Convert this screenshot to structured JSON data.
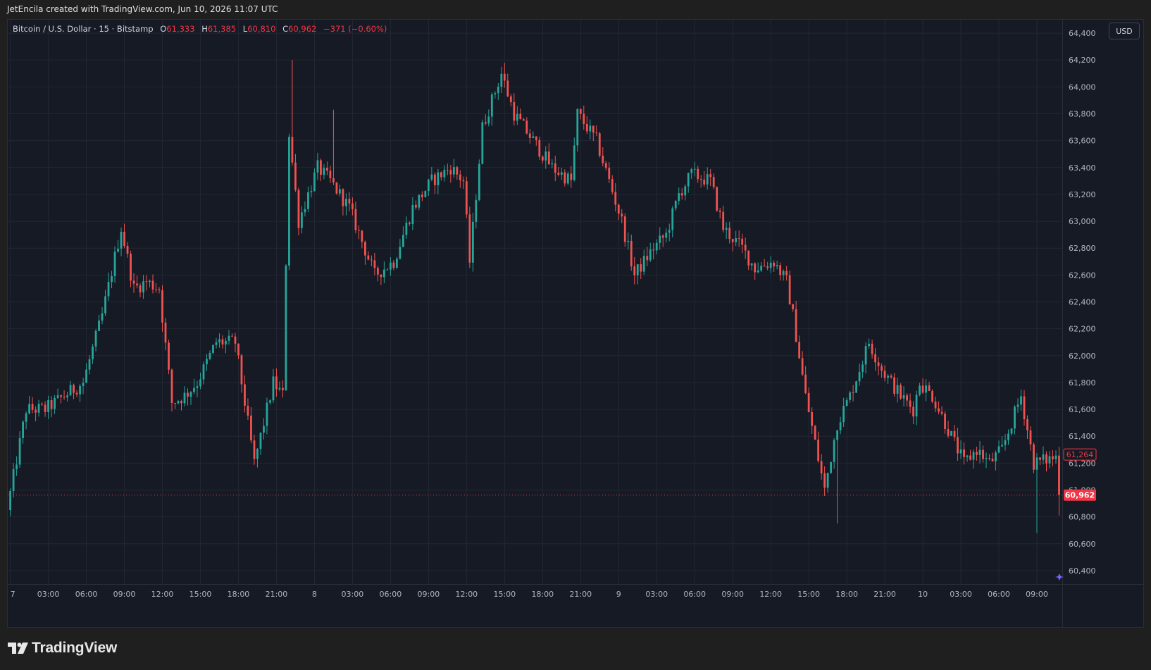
{
  "caption": "JetEncila created with TradingView.com, Jun 10, 2026 11:07 UTC",
  "legend": {
    "symbol": "Bitcoin / U.S. Dollar · 15 · Bitstamp",
    "open_label": "O",
    "open": "61,333",
    "high_label": "H",
    "high": "61,385",
    "low_label": "L",
    "low": "60,810",
    "close_label": "C",
    "close": "60,962",
    "change": "−371 (−0.60%)"
  },
  "currency_button": "USD",
  "footer_brand": "TradingView",
  "colors": {
    "up": "#26a69a",
    "down": "#ef5350",
    "background": "#161a25",
    "grid": "#232733",
    "axis_text": "#b2b5be",
    "last_price_bg": "#f23645",
    "prev_label_border": "#f23645",
    "accent_marker": "#7b61ff"
  },
  "chart_data": {
    "type": "candlestick",
    "symbol": "Bitcoin / U.S. Dollar",
    "interval": "15",
    "exchange": "Bitstamp",
    "currency": "USD",
    "ylim": [
      60300,
      64500
    ],
    "y_ticks": [
      60400,
      60600,
      60800,
      61000,
      61200,
      61400,
      61600,
      61800,
      62000,
      62200,
      62400,
      62600,
      62800,
      63000,
      63200,
      63400,
      63600,
      63800,
      64000,
      64200,
      64400
    ],
    "y_tick_labels": [
      "60,400",
      "60,600",
      "60,800",
      "61,000",
      "61,200",
      "61,400",
      "61,600",
      "61,800",
      "62,000",
      "62,200",
      "62,400",
      "62,600",
      "62,800",
      "63,000",
      "63,200",
      "63,400",
      "63,600",
      "63,800",
      "64,000",
      "64,200",
      "64,400"
    ],
    "x_ticks": [
      "7",
      "03:00",
      "06:00",
      "09:00",
      "12:00",
      "15:00",
      "18:00",
      "21:00",
      "8",
      "03:00",
      "06:00",
      "09:00",
      "12:00",
      "15:00",
      "18:00",
      "21:00",
      "9",
      "03:00",
      "06:00",
      "09:00",
      "12:00",
      "15:00",
      "18:00",
      "21:00",
      "10",
      "03:00",
      "06:00",
      "09:00"
    ],
    "x_tick_hours": [
      0,
      3,
      6,
      9,
      12,
      15,
      18,
      21,
      24,
      27,
      30,
      33,
      36,
      39,
      42,
      45,
      48,
      51,
      54,
      57,
      60,
      63,
      66,
      69,
      72,
      75,
      78,
      81
    ],
    "x_range_hours": [
      -0.2,
      83.0
    ],
    "candle_minutes": 15,
    "last_price": 60962,
    "last_price_label": "60,962",
    "prev_price": 61264,
    "prev_price_label": "61,264",
    "price_path": [
      [
        0,
        60850
      ],
      [
        1.5,
        61600
      ],
      [
        3,
        61600
      ],
      [
        4.5,
        61700
      ],
      [
        6,
        61800
      ],
      [
        7.5,
        62300
      ],
      [
        9,
        62950
      ],
      [
        10,
        62500
      ],
      [
        11,
        62550
      ],
      [
        12,
        62500
      ],
      [
        13,
        61650
      ],
      [
        14,
        61700
      ],
      [
        15,
        61800
      ],
      [
        16.5,
        62100
      ],
      [
        18,
        62100
      ],
      [
        19.5,
        61200
      ],
      [
        21,
        61800
      ],
      [
        21.8,
        61700
      ],
      [
        22.2,
        63700
      ],
      [
        23,
        63000
      ],
      [
        24.5,
        63400
      ],
      [
        25.5,
        63300
      ],
      [
        27,
        63100
      ],
      [
        29,
        62600
      ],
      [
        30.5,
        62700
      ],
      [
        32,
        63100
      ],
      [
        33.5,
        63300
      ],
      [
        35,
        63400
      ],
      [
        36,
        63300
      ],
      [
        36.5,
        62700
      ],
      [
        37.5,
        63700
      ],
      [
        39,
        64100
      ],
      [
        40,
        63800
      ],
      [
        41.5,
        63600
      ],
      [
        43,
        63400
      ],
      [
        44.5,
        63300
      ],
      [
        45,
        63800
      ],
      [
        46.5,
        63600
      ],
      [
        47.5,
        63300
      ],
      [
        48.5,
        63000
      ],
      [
        49.5,
        62600
      ],
      [
        51,
        62800
      ],
      [
        52,
        62900
      ],
      [
        53,
        63200
      ],
      [
        54,
        63350
      ],
      [
        55.5,
        63300
      ],
      [
        56.5,
        62950
      ],
      [
        58,
        62800
      ],
      [
        59,
        62650
      ],
      [
        60.5,
        62700
      ],
      [
        61.5,
        62550
      ],
      [
        62,
        62300
      ],
      [
        63,
        61700
      ],
      [
        64.5,
        61000
      ],
      [
        65.5,
        61500
      ],
      [
        66.5,
        61700
      ],
      [
        68,
        62100
      ],
      [
        69,
        61900
      ],
      [
        70.5,
        61700
      ],
      [
        71.5,
        61600
      ],
      [
        72,
        61800
      ],
      [
        73,
        61700
      ],
      [
        74,
        61500
      ],
      [
        75.5,
        61200
      ],
      [
        76.5,
        61300
      ],
      [
        77.5,
        61200
      ],
      [
        78.5,
        61300
      ],
      [
        80,
        61700
      ],
      [
        81,
        61200
      ],
      [
        82.9,
        61250
      ]
    ],
    "spikes": [
      {
        "hour": 22.2,
        "high": 64200
      },
      {
        "hour": 39.1,
        "high": 64180
      },
      {
        "hour": 65.2,
        "low": 60750
      },
      {
        "hour": 81.1,
        "low": 60680
      },
      {
        "hour": 9.0,
        "high": 62940
      },
      {
        "hour": 25.6,
        "high": 63830
      }
    ]
  }
}
